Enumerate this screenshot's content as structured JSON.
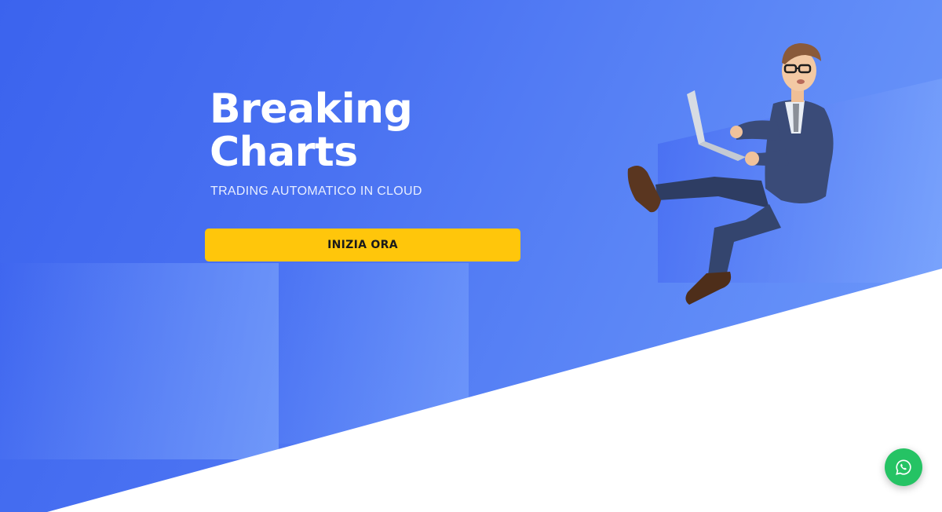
{
  "hero": {
    "title_line1": "Breaking",
    "title_line2": "Charts",
    "subtitle": "TRADING AUTOMATICO IN CLOUD",
    "cta_label": "INIZIA ORA"
  },
  "icons": {
    "chat": "whatsapp-icon",
    "illustration": "businessman-with-laptop-illustration"
  },
  "colors": {
    "background_blue": "#4a72f2",
    "cta_yellow": "#ffc60b",
    "whatsapp_green": "#25c364",
    "text_white": "#ffffff"
  }
}
